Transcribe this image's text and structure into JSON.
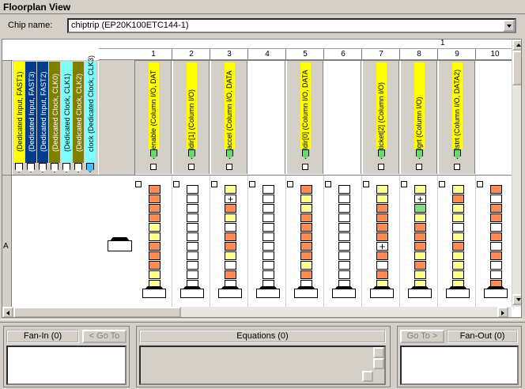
{
  "window": {
    "title": "Floorplan View"
  },
  "chip": {
    "label": "Chip name:",
    "value": "chiptrip (EP20K100ETC144-1)"
  },
  "header": {
    "group_label": "1",
    "columns": [
      "1",
      "2",
      "3",
      "4",
      "5",
      "6",
      "7",
      "8",
      "9",
      "10"
    ]
  },
  "row_label": "A",
  "dedicated_pins": [
    {
      "label": "(Dedicated Input, FAST1)",
      "color": "#ffff00"
    },
    {
      "label": "(Dedicated Input, FAST3)",
      "color": "#003c8c"
    },
    {
      "label": "(Dedicated Input, FAST2)",
      "color": "#003c8c"
    },
    {
      "label": "(Dedicated Clock, CLK0)",
      "color": "#808000"
    },
    {
      "label": "(Dedicated Clock, CLK1)",
      "color": "#80ffff"
    },
    {
      "label": "(Dedicated Clock, CLK2)",
      "color": "#808000"
    },
    {
      "label": "clock (Dedicated Clock, CLK3)",
      "color": "#80ffff"
    }
  ],
  "io_columns": [
    {
      "col": 1,
      "label": "enable (Column I/O, DAT"
    },
    {
      "col": 2,
      "label": "ldir[1] (Column I/O)"
    },
    {
      "col": 3,
      "label": "accel (Column I/O, DATA"
    },
    {
      "col": 5,
      "label": "ldir[0] (Column I/O, DATA"
    },
    {
      "col": 7,
      "label": "ticket[2] (Column I/O)"
    },
    {
      "col": 8,
      "label": "lgrt (Column I/O)"
    },
    {
      "col": 9,
      "label": "lstrt (Column I/O, DATA2)"
    }
  ],
  "labs": [
    "ooooyyoooyyy",
    "wwwwwwwwwwww",
    "yxoywooywowo",
    "wwwwwwwwwwww",
    "oyyoooooyowo",
    "wwwwwwwwwwww",
    "yyooooxowoyo",
    "yxgyoooyoyyo",
    "yoyywyoyyyyw",
    "owoowowowwow"
  ],
  "panels": {
    "fanin": {
      "label": "Fan-In (0)",
      "goto": "< Go To"
    },
    "equations": {
      "label": "Equations (0)"
    },
    "fanout": {
      "label": "Fan-Out (0)",
      "goto": "Go To >"
    }
  }
}
